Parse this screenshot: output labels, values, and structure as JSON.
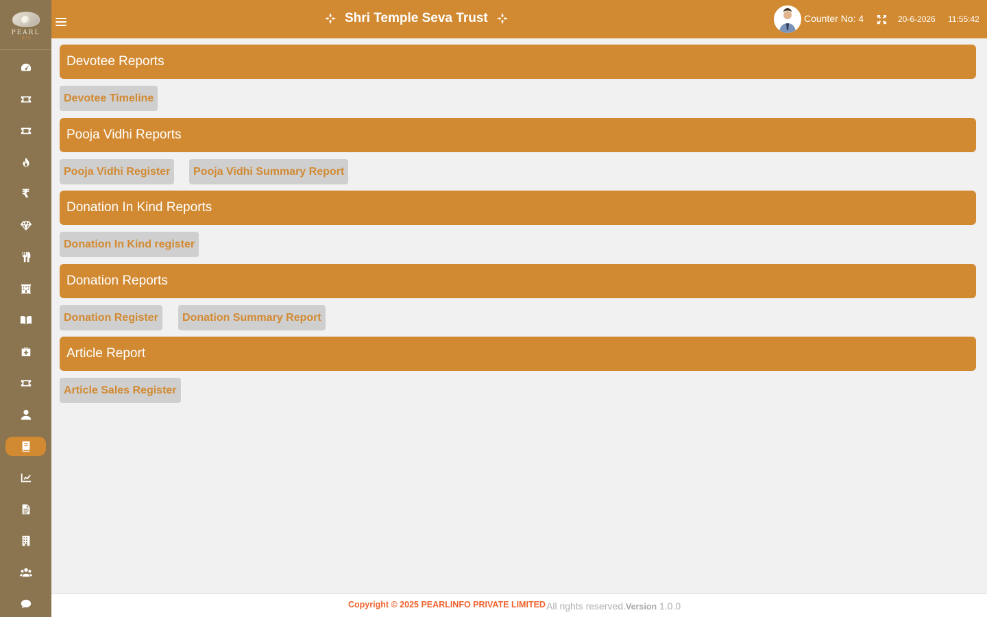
{
  "brand": {
    "logo_text": "PEARL",
    "logo_sub": "INFO"
  },
  "header": {
    "title": "Shri Temple Seva Trust",
    "counter": "Counter No: 4",
    "date": "20-6-2026",
    "time": "11:55:42"
  },
  "sidebar": {
    "active_index": 12,
    "items": [
      {
        "icon": "dashboard-icon"
      },
      {
        "icon": "ticket-icon"
      },
      {
        "icon": "ticket-icon"
      },
      {
        "icon": "fire-icon"
      },
      {
        "icon": "rupee-icon"
      },
      {
        "icon": "gem-icon"
      },
      {
        "icon": "utensils-icon"
      },
      {
        "icon": "building-icon"
      },
      {
        "icon": "book-open-icon"
      },
      {
        "icon": "medkit-icon"
      },
      {
        "icon": "ticket-icon"
      },
      {
        "icon": "user-icon"
      },
      {
        "icon": "book-icon"
      },
      {
        "icon": "chart-line-icon"
      },
      {
        "icon": "file-icon"
      },
      {
        "icon": "office-building-icon"
      },
      {
        "icon": "users-icon"
      },
      {
        "icon": "comment-icon"
      }
    ]
  },
  "sections": [
    {
      "title": "Devotee Reports",
      "buttons": [
        "Devotee Timeline"
      ]
    },
    {
      "title": "Pooja Vidhi Reports",
      "buttons": [
        "Pooja Vidhi Register",
        "Pooja Vidhi Summary Report"
      ]
    },
    {
      "title": "Donation In Kind Reports",
      "buttons": [
        "Donation In Kind register"
      ]
    },
    {
      "title": "Donation Reports",
      "buttons": [
        "Donation Register",
        "Donation Summary Report"
      ]
    },
    {
      "title": "Article Report",
      "buttons": [
        "Article Sales Register"
      ]
    }
  ],
  "footer": {
    "copyright": "Copyright © 2025 PEARLINFO PRIVATE LIMITED",
    "rights": "All rights reserved.",
    "version_label": "Version",
    "version": "1.0.0"
  },
  "colors": {
    "accent": "#d28a32",
    "sidebar": "#8a7550",
    "background": "#f1f1f1",
    "button": "#cfcfcf",
    "copyright": "#f0622c"
  }
}
